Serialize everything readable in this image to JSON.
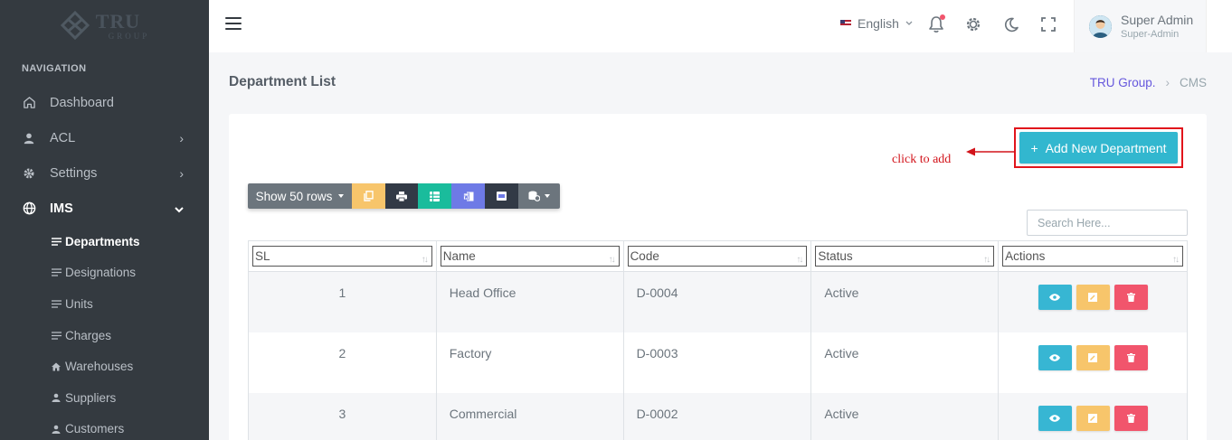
{
  "brand": {
    "name": "TRU",
    "sub": "GROUP"
  },
  "sidebar": {
    "heading": "NAVIGATION",
    "items": [
      {
        "label": "Dashboard",
        "icon": "home-icon"
      },
      {
        "label": "ACL",
        "icon": "user-icon"
      },
      {
        "label": "Settings",
        "icon": "gear-icon"
      },
      {
        "label": "IMS",
        "icon": "globe-icon"
      }
    ],
    "subitems": [
      {
        "label": "Departments",
        "icon": "list-icon"
      },
      {
        "label": "Designations",
        "icon": "list-icon"
      },
      {
        "label": "Units",
        "icon": "list-icon"
      },
      {
        "label": "Charges",
        "icon": "list-icon"
      },
      {
        "label": "Warehouses",
        "icon": "home-icon"
      },
      {
        "label": "Suppliers",
        "icon": "user-icon"
      },
      {
        "label": "Customers",
        "icon": "user-icon"
      }
    ]
  },
  "topbar": {
    "language": "English",
    "user": {
      "name": "Super Admin",
      "role": "Super-Admin"
    }
  },
  "page": {
    "title": "Department List",
    "breadcrumb": [
      "TRU Group.",
      "CMS"
    ]
  },
  "toolbar": {
    "add_button": "Add New Department",
    "annotation": "click to add",
    "show_rows": "Show 50 rows",
    "search_placeholder": "Search Here..."
  },
  "table": {
    "columns": [
      "SL",
      "Name",
      "Code",
      "Status",
      "Actions"
    ],
    "rows": [
      {
        "sl": "1",
        "name": "Head Office",
        "code": "D-0004",
        "status": "Active"
      },
      {
        "sl": "2",
        "name": "Factory",
        "code": "D-0003",
        "status": "Active"
      },
      {
        "sl": "3",
        "name": "Commercial",
        "code": "D-0002",
        "status": "Active"
      }
    ]
  },
  "colors": {
    "sidebar": "#343a40",
    "accent": "#32b7cf",
    "warning": "#f7c56b",
    "danger": "#f1556c",
    "annotation": "#e1141b"
  }
}
